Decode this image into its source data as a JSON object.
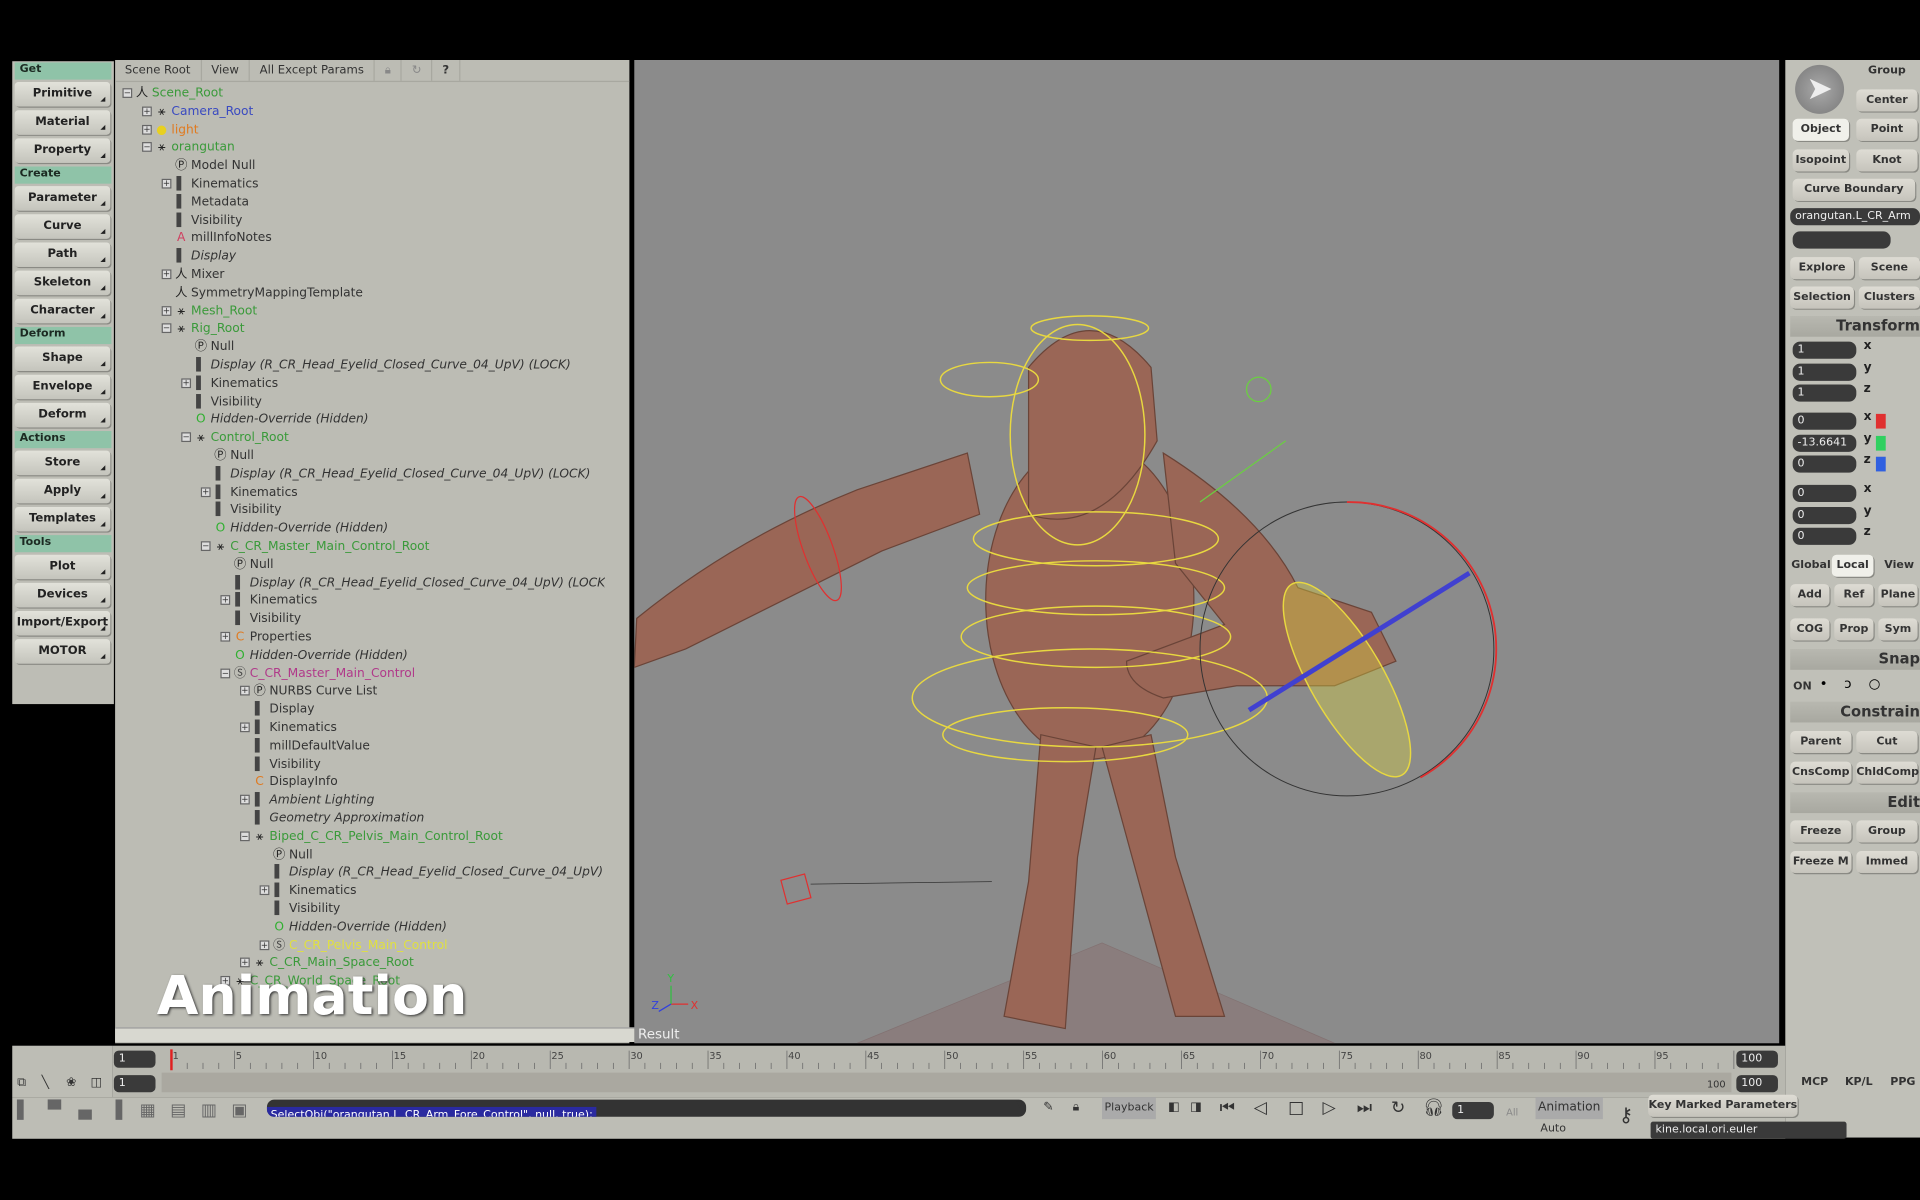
{
  "left_toolbar": {
    "sections": [
      {
        "header": "Get",
        "buttons": [
          "Primitive",
          "Material",
          "Property"
        ]
      },
      {
        "header": "Create",
        "buttons": [
          "Parameter",
          "Curve",
          "Path",
          "Skeleton",
          "Character"
        ]
      },
      {
        "header": "Deform",
        "buttons": [
          "Shape",
          "Envelope",
          "Deform"
        ]
      },
      {
        "header": "Actions",
        "buttons": [
          "Store",
          "Apply",
          "Templates"
        ]
      },
      {
        "header": "Tools",
        "buttons": [
          "Plot",
          "Devices",
          "Import/Export",
          "MOTOR"
        ]
      }
    ]
  },
  "explorer": {
    "menus": [
      "Scene Root",
      "View",
      "All Except Params"
    ],
    "help": "?",
    "tree": [
      {
        "d": 0,
        "t": "Scene_Root",
        "c": "#3a9a3a",
        "e": "-",
        "i": "skel"
      },
      {
        "d": 1,
        "t": "Camera_Root",
        "c": "#3a4ac0",
        "e": "+",
        "i": "model"
      },
      {
        "d": 1,
        "t": "light",
        "c": "#e07a20",
        "e": "+",
        "i": "light"
      },
      {
        "d": 1,
        "t": "orangutan",
        "c": "#3a9a3a",
        "e": "-",
        "i": "model"
      },
      {
        "d": 2,
        "t": "Model Null",
        "i": "p"
      },
      {
        "d": 2,
        "t": "Kinematics",
        "e": "+",
        "i": "bar"
      },
      {
        "d": 2,
        "t": "Metadata",
        "i": "bar"
      },
      {
        "d": 2,
        "t": "Visibility",
        "i": "bar"
      },
      {
        "d": 2,
        "t": "millInfoNotes",
        "i": "a"
      },
      {
        "d": 2,
        "t": "Display",
        "i": "bar",
        "it": true
      },
      {
        "d": 2,
        "t": "Mixer",
        "e": "+",
        "i": "skel"
      },
      {
        "d": 2,
        "t": "SymmetryMappingTemplate",
        "i": "skel"
      },
      {
        "d": 2,
        "t": "Mesh_Root",
        "c": "#3a9a3a",
        "e": "+",
        "i": "model"
      },
      {
        "d": 2,
        "t": "Rig_Root",
        "c": "#3a9a3a",
        "e": "-",
        "i": "model"
      },
      {
        "d": 3,
        "t": "Null",
        "i": "p"
      },
      {
        "d": 3,
        "t": "Display (R_CR_Head_Eyelid_Closed_Curve_04_UpV) (LOCK)",
        "i": "bar",
        "it": true
      },
      {
        "d": 3,
        "t": "Kinematics",
        "e": "+",
        "i": "bar"
      },
      {
        "d": 3,
        "t": "Visibility",
        "i": "bar"
      },
      {
        "d": 3,
        "t": "Hidden-Override (Hidden)",
        "i": "o",
        "it": true
      },
      {
        "d": 3,
        "t": "Control_Root",
        "c": "#3a9a3a",
        "e": "-",
        "i": "model"
      },
      {
        "d": 4,
        "t": "Null",
        "i": "p"
      },
      {
        "d": 4,
        "t": "Display (R_CR_Head_Eyelid_Closed_Curve_04_UpV) (LOCK)",
        "i": "bar",
        "it": true
      },
      {
        "d": 4,
        "t": "Kinematics",
        "e": "+",
        "i": "bar"
      },
      {
        "d": 4,
        "t": "Visibility",
        "i": "bar"
      },
      {
        "d": 4,
        "t": "Hidden-Override (Hidden)",
        "i": "o",
        "it": true
      },
      {
        "d": 4,
        "t": "C_CR_Master_Main_Control_Root",
        "c": "#3a9a3a",
        "e": "-",
        "i": "model"
      },
      {
        "d": 5,
        "t": "Null",
        "i": "p"
      },
      {
        "d": 5,
        "t": "Display (R_CR_Head_Eyelid_Closed_Curve_04_UpV) (LOCK)",
        "i": "bar",
        "it": true
      },
      {
        "d": 5,
        "t": "Kinematics",
        "e": "+",
        "i": "bar"
      },
      {
        "d": 5,
        "t": "Visibility",
        "i": "bar"
      },
      {
        "d": 5,
        "t": "Properties",
        "e": "+",
        "i": "c"
      },
      {
        "d": 5,
        "t": "Hidden-Override (Hidden)",
        "i": "o",
        "it": true
      },
      {
        "d": 5,
        "t": "C_CR_Master_Main_Control",
        "c": "#b03a8a",
        "e": "-",
        "i": "s"
      },
      {
        "d": 6,
        "t": "NURBS Curve List",
        "e": "+",
        "i": "p"
      },
      {
        "d": 6,
        "t": "Display",
        "i": "bar"
      },
      {
        "d": 6,
        "t": "Kinematics",
        "e": "+",
        "i": "bar"
      },
      {
        "d": 6,
        "t": "millDefaultValue",
        "i": "bar"
      },
      {
        "d": 6,
        "t": "Visibility",
        "i": "bar"
      },
      {
        "d": 6,
        "t": "DisplayInfo",
        "i": "c"
      },
      {
        "d": 6,
        "t": "Ambient Lighting",
        "e": "+",
        "i": "bar",
        "it": true
      },
      {
        "d": 6,
        "t": "Geometry Approximation",
        "i": "bar",
        "it": true
      },
      {
        "d": 6,
        "t": "Biped_C_CR_Pelvis_Main_Control_Root",
        "c": "#3a9a3a",
        "e": "-",
        "i": "model"
      },
      {
        "d": 7,
        "t": "Null",
        "i": "p"
      },
      {
        "d": 7,
        "t": "Display (R_CR_Head_Eyelid_Closed_Curve_04_UpV) (LOCK)",
        "i": "bar",
        "it": true
      },
      {
        "d": 7,
        "t": "Kinematics",
        "e": "+",
        "i": "bar"
      },
      {
        "d": 7,
        "t": "Visibility",
        "i": "bar"
      },
      {
        "d": 7,
        "t": "Hidden-Override (Hidden)",
        "i": "o",
        "it": true
      },
      {
        "d": 7,
        "t": "C_CR_Pelvis_Main_Control",
        "c": "#e0e040",
        "e": "+",
        "i": "s"
      },
      {
        "d": 6,
        "t": "C_CR_Main_Space_Root",
        "c": "#3a9a3a",
        "e": "+",
        "i": "model"
      },
      {
        "d": 5,
        "t": "C_CR_World_Space_Root",
        "c": "#3a9a3a",
        "e": "+",
        "i": "model"
      }
    ]
  },
  "viewport": {
    "label": "Result",
    "caption": "Animation",
    "axes": {
      "x": "X",
      "y": "Y",
      "z": "Z"
    }
  },
  "right_panel": {
    "select_buttons": [
      "Group",
      "Center",
      "Object",
      "Point",
      "Isopoint",
      "Knot",
      "Curve Boundary"
    ],
    "selection_name": "orangutan.L_CR_Arm",
    "explore_buttons": [
      "Explore",
      "Scene",
      "Selection",
      "Clusters"
    ],
    "transform_header": "Transform",
    "scale": [
      "1",
      "1",
      "1"
    ],
    "rotation": [
      "0",
      "-13.6641",
      "0"
    ],
    "translation": [
      "0",
      "0",
      "0"
    ],
    "axis_labels": [
      "x",
      "y",
      "z"
    ],
    "axis_colors": [
      "#e03030",
      "#30d060",
      "#3060e0"
    ],
    "ref_modes": [
      "Global",
      "Local",
      "View"
    ],
    "ref_buttons": [
      "Add",
      "Ref",
      "Plane"
    ],
    "cog_buttons": [
      "COG",
      "Prop",
      "Sym"
    ],
    "snap_header": "Snap",
    "snap_on": "ON",
    "constrain_header": "Constrain",
    "constrain_buttons": [
      "Parent",
      "Cut",
      "CnsComp",
      "ChldComp"
    ],
    "edit_header": "Edit",
    "edit_buttons": [
      "Freeze",
      "Group",
      "Freeze M",
      "Immed"
    ],
    "tabs": [
      "MCP",
      "KP/L",
      "PPG"
    ]
  },
  "timeline": {
    "start": 1,
    "end": 100,
    "current": 1,
    "start_field": "1",
    "end_field": "100",
    "range_start": "1",
    "range_end_label": "100",
    "range_end_field": "100",
    "playhead_color": "#e02020"
  },
  "bottom": {
    "command": "SelectObj(\"orangutan.L_CR_Arm_Fore_Control\", null, true);",
    "playback_label": "Playback",
    "frame_field": "1",
    "all_label": "All",
    "animation_label": "Animation",
    "auto_label": "Auto",
    "key_marked": "Key Marked Parameters",
    "param_field": "kine.local.ori.euler"
  }
}
